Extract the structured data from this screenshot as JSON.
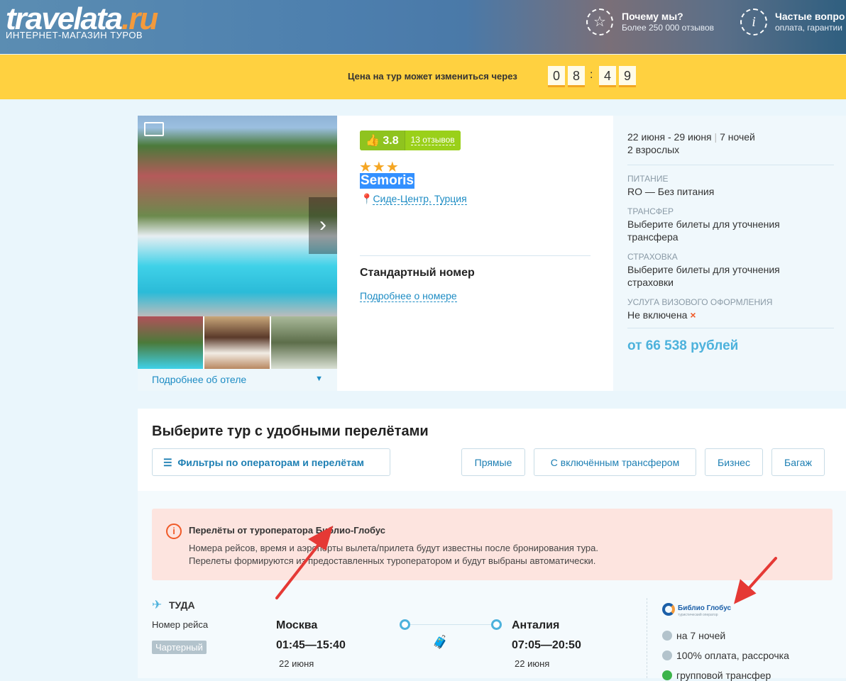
{
  "header": {
    "logo_main": "travelata",
    "logo_tld": ".ru",
    "tagline": "ИНТЕРНЕТ-МАГАЗИН ТУРОВ",
    "why": {
      "title": "Почему мы?",
      "subtitle": "Более 250 000 отзывов"
    },
    "faq": {
      "title": "Частые вопро",
      "subtitle": "оплата, гарантии"
    }
  },
  "timer": {
    "label": "Цена на тур может измениться через",
    "digits": [
      "0",
      "8",
      "4",
      "9"
    ],
    "separator": ":"
  },
  "hotel": {
    "rating": "3.8",
    "reviews": "13 отзывов",
    "stars": 3,
    "name": "Semoris",
    "location": "Сиде-Центр, Турция",
    "room": "Стандартный номер",
    "room_link": "Подробнее о номере",
    "hotel_link": "Подробнее об отеле",
    "dates": "22 июня - 29 июня",
    "nights": "7 ночей",
    "guests": "2 взрослых",
    "meal_label": "ПИТАНИЕ",
    "meal": "RO — Без питания",
    "transfer_label": "ТРАНСФЕР",
    "transfer": "Выберите билеты для уточнения трансфера",
    "insurance_label": "СТРАХОВКА",
    "insurance": "Выберите билеты для уточнения страховки",
    "visa_label": "УСЛУГА ВИЗОВОГО ОФОРМЛЕНИЯ",
    "visa": "Не включена",
    "price": "от 66 538 рублей"
  },
  "tours": {
    "title": "Выберите тур с удобными перелётами",
    "filter_button": "Фильтры по операторам и перелётам",
    "chips": [
      "Прямые",
      "С включённым трансфером",
      "Бизнес",
      "Багаж"
    ],
    "alert": {
      "title": "Перелёты от туроператора Библио-Глобус",
      "line1": "Номера рейсов, время и аэропорты вылета/прилета будут известны после бронирования тура.",
      "line2": "Перелеты формируются из предоставленных туроператором и будут выбраны автоматически."
    },
    "flight": {
      "direction": "ТУДА",
      "flight_number_label": "Номер рейса",
      "type": "Чартерный",
      "from_city": "Москва",
      "from_time": "01:45—15:40",
      "from_date": "22 июня",
      "to_city": "Анталия",
      "to_time": "07:05—20:50",
      "to_date": "22 июня"
    },
    "operator": {
      "name": "Библио Глобус",
      "sub": "туристический оператор",
      "features": [
        "на 7 ночей",
        "100% оплата, рассрочка",
        "групповой трансфер"
      ]
    }
  },
  "colors": {
    "accent": "#1d8cc4",
    "timer_bg": "#ffd140",
    "alert_bg": "#fde4df",
    "rating": "#8fc31f",
    "arrow": "#e53935"
  }
}
